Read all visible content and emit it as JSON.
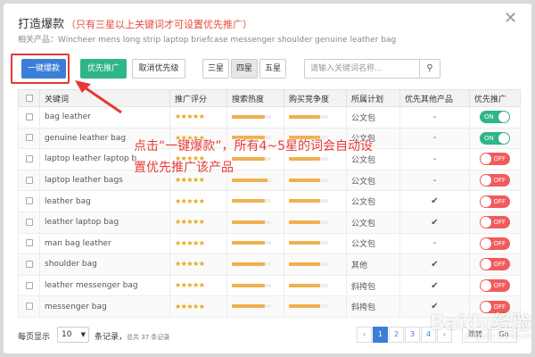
{
  "dialog": {
    "title": "打造爆款",
    "title_hint": "（只有三星以上关键词才可设置优先推广）",
    "subtitle": "相关产品：Wincheer mens long strip laptop briefcase messenger shoulder genuine leather bag",
    "close_icon": "close-icon"
  },
  "toolbar": {
    "one_click_label": "一键爆款",
    "priority_label": "优先推广",
    "cancel_priority_label": "取消优先级",
    "star_filters": [
      "三星",
      "四星",
      "五星"
    ],
    "active_star_filter": "四星",
    "search_placeholder": "请输入关键词名称...",
    "search_icon": "search-icon",
    "colors": {
      "primary": "#3a7fd5",
      "success": "#2fb58a",
      "danger": "#f15b5b"
    }
  },
  "table": {
    "headers": [
      "关键词",
      "推广评分",
      "搜索热度",
      "购买竞争度",
      "所属计划",
      "优先其他产品",
      "优先推广"
    ],
    "rows": [
      {
        "keyword": "bag leather",
        "score": "★★★★★",
        "heat": 0.85,
        "competition": 0.8,
        "plan": "公文包",
        "other": "-",
        "toggle": "ON"
      },
      {
        "keyword": "genuine leather bag",
        "score": "★★★★★",
        "heat": 0.85,
        "competition": 0.8,
        "plan": "公文包",
        "other": "-",
        "toggle": "ON"
      },
      {
        "keyword": "laptop leather laptop b",
        "score": "★★★★★",
        "heat": 0.85,
        "competition": 0.8,
        "plan": "公文包",
        "other": "-",
        "toggle": "OFF"
      },
      {
        "keyword": "laptop leather bags",
        "score": "★★★★★",
        "heat": 0.9,
        "competition": 0.8,
        "plan": "公文包",
        "other": "-",
        "toggle": "OFF"
      },
      {
        "keyword": "leather bag",
        "score": "★★★★★",
        "heat": 0.85,
        "competition": 0.8,
        "plan": "公文包",
        "other": "✔",
        "toggle": "OFF"
      },
      {
        "keyword": "leather laptop bag",
        "score": "★★★★★",
        "heat": 0.85,
        "competition": 0.8,
        "plan": "公文包",
        "other": "✔",
        "toggle": "OFF"
      },
      {
        "keyword": "man bag leather",
        "score": "★★★★★",
        "heat": 0.85,
        "competition": 0.8,
        "plan": "公文包",
        "other": "-",
        "toggle": "OFF"
      },
      {
        "keyword": "shoulder bag",
        "score": "★★★★★",
        "heat": 0.85,
        "competition": 0.8,
        "plan": "其他",
        "other": "✔",
        "toggle": "OFF"
      },
      {
        "keyword": "leather messenger bag",
        "score": "★★★★★",
        "heat": 0.85,
        "competition": 0.8,
        "plan": "斜挎包",
        "other": "✔",
        "toggle": "OFF"
      },
      {
        "keyword": "messenger bag",
        "score": "★★★★★",
        "heat": 0.85,
        "competition": 0.8,
        "plan": "斜挎包",
        "other": "✔",
        "toggle": "OFF"
      }
    ]
  },
  "annotation": {
    "text": "点击“一键爆款”，所有4~5星的词会自动设置优先推广该产品",
    "color": "#e53935"
  },
  "footer": {
    "per_page_label": "每页显示",
    "per_page_value": "10",
    "records_label": "条记录，",
    "total_text": "总共 37 条记录",
    "pages": [
      "‹",
      "1",
      "2",
      "3",
      "4",
      "›"
    ],
    "current_page": "1",
    "goto_label": "跳转",
    "go_label": "Go"
  },
  "watermark": {
    "text": "Baidu经验",
    "sub": "jingyan.baidu.com"
  }
}
